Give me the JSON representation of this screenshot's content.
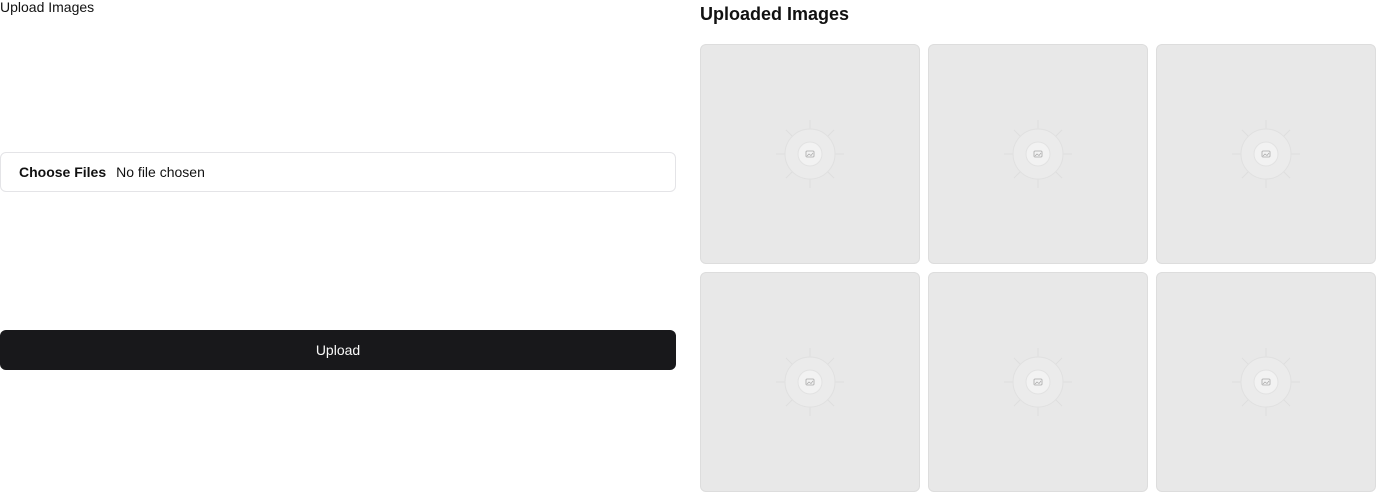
{
  "upload": {
    "label": "Upload Images",
    "choose_button": "Choose Files",
    "file_status": "No file chosen",
    "submit_label": "Upload"
  },
  "gallery": {
    "title": "Uploaded Images",
    "images": [
      {
        "icon": "image-placeholder-icon"
      },
      {
        "icon": "image-placeholder-icon"
      },
      {
        "icon": "image-placeholder-icon"
      },
      {
        "icon": "image-placeholder-icon"
      },
      {
        "icon": "image-placeholder-icon"
      },
      {
        "icon": "image-placeholder-icon"
      }
    ]
  },
  "colors": {
    "button_bg": "#18181b",
    "button_text": "#fafafa",
    "tile_bg": "#e8e8e8",
    "input_border": "#e4e4e7"
  }
}
